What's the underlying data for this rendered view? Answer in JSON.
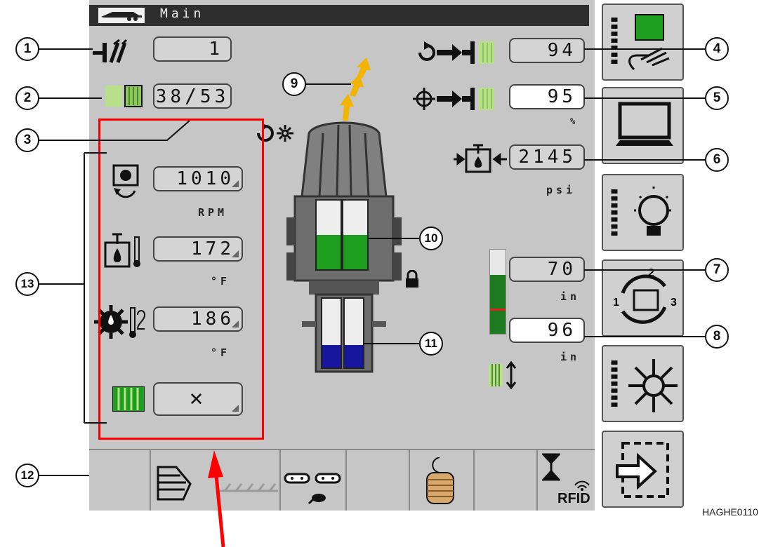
{
  "title_bar": {
    "title": "Main"
  },
  "fields": {
    "f1": "1",
    "f2_left": "38",
    "f2_right": "53",
    "f4": "94",
    "f5": "95",
    "f6": "2145",
    "f7": "70",
    "f8": "96",
    "engine_speed": "1010",
    "hydraulic_temp": "172",
    "oil_temp": "186",
    "status_x": "✕"
  },
  "units": {
    "percent": "%",
    "pressure": "psi",
    "length1": "in",
    "length2": "in",
    "rpm": "RPM",
    "deg1": "°F",
    "deg2": "°F"
  },
  "callouts": [
    "1",
    "2",
    "3",
    "4",
    "5",
    "6",
    "7",
    "8",
    "9",
    "10",
    "11",
    "12",
    "13"
  ],
  "bottom_bar": {
    "rfid_label": "RFID"
  },
  "side_buttons": [
    "screen-select-button",
    "monitor-button",
    "lights-button",
    "cycle-button",
    "rotor-button",
    "exit-button"
  ],
  "reference_code": "HAGHE0110",
  "colors": {
    "screen_bg": "#c6c6c6",
    "highlight": "#ff0000",
    "fill_green": "#1e9e1e",
    "fill_blue": "#16169e",
    "arrow_yellow": "#f2b400"
  },
  "level_gauge": {
    "fill_percent": 70
  }
}
